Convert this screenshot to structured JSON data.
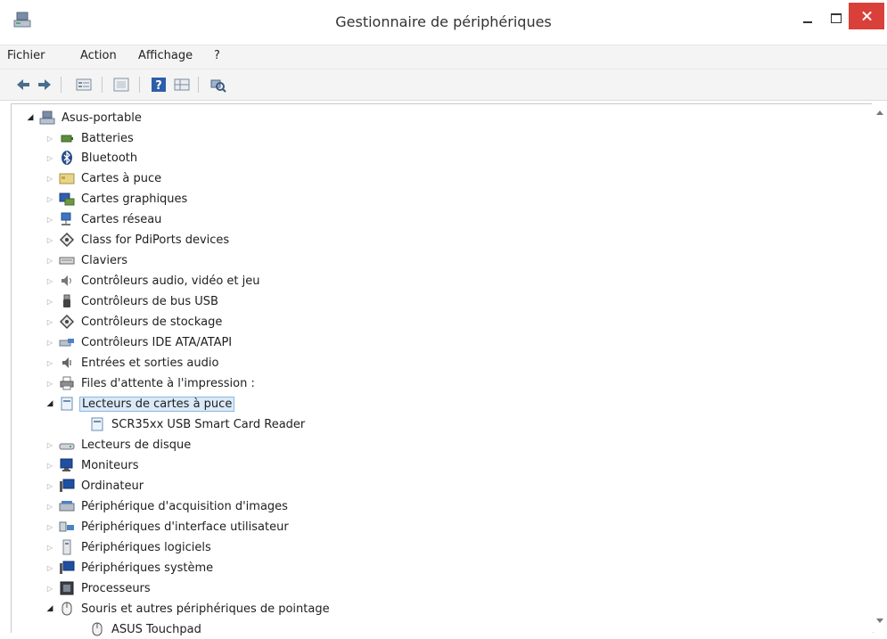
{
  "window": {
    "title": "Gestionnaire de périphériques",
    "icon": "device-manager-icon"
  },
  "menu": [
    "Fichier",
    "Action",
    "Affichage",
    "?"
  ],
  "toolbar": [
    "back-arrow-icon",
    "forward-arrow-icon",
    "properties-icon",
    "view-icon",
    "help-icon",
    "grid-icon",
    "scan-hardware-icon"
  ],
  "tree": {
    "root": "Asus-portable",
    "categories": [
      "Batteries",
      "Bluetooth",
      "Cartes à puce",
      "Cartes graphiques",
      "Cartes réseau",
      "Class for PdiPorts devices",
      "Claviers",
      "Contrôleurs audio, vidéo et jeu",
      "Contrôleurs de bus USB",
      "Contrôleurs de stockage",
      "Contrôleurs IDE ATA/ATAPI",
      "Entrées et sorties audio",
      "Files d'attente à l'impression :",
      "Lecteurs de cartes à puce",
      "SCR35xx USB Smart Card Reader",
      "Lecteurs de disque",
      "Moniteurs",
      "Ordinateur",
      "Périphérique d'acquisition d'images",
      "Périphériques d'interface utilisateur",
      "Périphériques logiciels",
      "Périphériques système",
      "Processeurs",
      "Souris et autres périphériques de pointage",
      "ASUS Touchpad"
    ]
  }
}
